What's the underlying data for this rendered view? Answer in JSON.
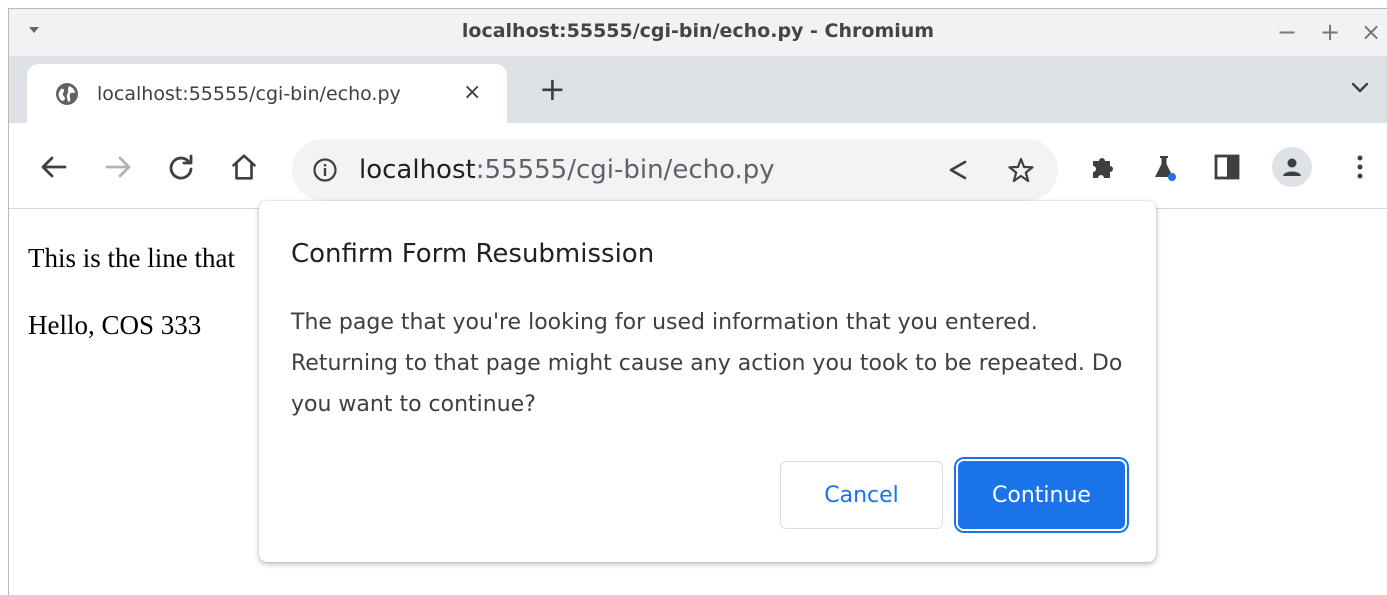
{
  "window": {
    "title": "localhost:55555/cgi-bin/echo.py - Chromium",
    "controls": {
      "minimize": "−",
      "maximize": "+",
      "close": "×"
    }
  },
  "tabs": [
    {
      "title": "localhost:55555/cgi-bin/echo.py",
      "icon": "globe-icon",
      "close": "×"
    }
  ],
  "new_tab_label": "+",
  "omnibox": {
    "host": "localhost",
    "rest": ":55555/cgi-bin/echo.py"
  },
  "page": {
    "lines": [
      "This is the line that",
      "Hello, COS 333"
    ]
  },
  "dialog": {
    "title": "Confirm Form Resubmission",
    "body": "The page that you're looking for used information that you entered. Returning to that page might cause any action you took to be repeated. Do you want to continue?",
    "cancel_label": "Cancel",
    "continue_label": "Continue"
  },
  "colors": {
    "accent": "#1a73e8",
    "tabstrip": "#dee1e6",
    "omnibox": "#f1f3f4"
  }
}
